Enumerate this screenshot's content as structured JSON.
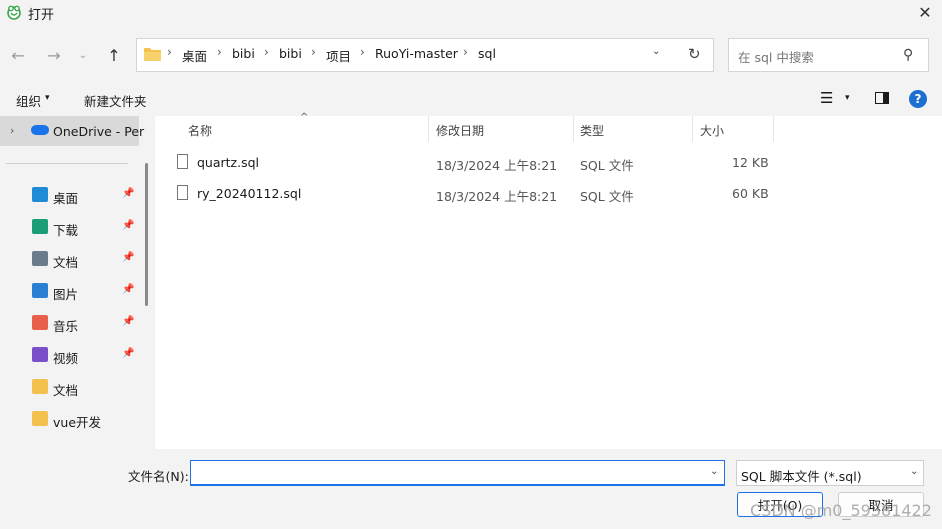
{
  "window": {
    "title": "打开",
    "close_glyph": "✕"
  },
  "nav": {
    "back_glyph": "←",
    "forward_glyph": "→",
    "recent_glyph": "⌄",
    "up_glyph": "↑",
    "breadcrumbs": [
      "桌面",
      "bibi",
      "bibi",
      "项目",
      "RuoYi-master",
      "sql"
    ],
    "sep_glyph": "›",
    "dropdown_glyph": "⌄",
    "refresh_glyph": "↻"
  },
  "search": {
    "placeholder": "在 sql 中搜索",
    "icon_glyph": "⚲"
  },
  "toolbar": {
    "organize_label": "组织",
    "caret": "▾",
    "new_folder_label": "新建文件夹",
    "view_glyph": "☰",
    "help_glyph": "?"
  },
  "sidebar": {
    "onedrive": {
      "label": "OneDrive - Per",
      "chev": "›"
    },
    "pin_glyph": "📌",
    "items": [
      {
        "label": "桌面",
        "icon": "desktop-icon",
        "color": "#1f8ad6",
        "pinned": true
      },
      {
        "label": "下载",
        "icon": "download-icon",
        "color": "#1b9e77",
        "pinned": true
      },
      {
        "label": "文档",
        "icon": "documents-icon",
        "color": "#6b7b8c",
        "pinned": true
      },
      {
        "label": "图片",
        "icon": "pictures-icon",
        "color": "#2a7fd4",
        "pinned": true
      },
      {
        "label": "音乐",
        "icon": "music-icon",
        "color": "#e8604c",
        "pinned": true
      },
      {
        "label": "视频",
        "icon": "videos-icon",
        "color": "#7a4fc9",
        "pinned": true
      },
      {
        "label": "文档",
        "icon": "folder-icon",
        "color": "#f2c14e",
        "pinned": false
      },
      {
        "label": "vue开发",
        "icon": "folder-icon",
        "color": "#f2c14e",
        "pinned": false
      }
    ]
  },
  "columns": {
    "name": "名称",
    "sort_glyph": "^",
    "modified": "修改日期",
    "type": "类型",
    "size": "大小"
  },
  "files": [
    {
      "name": "quartz.sql",
      "modified": "18/3/2024 上午8:21",
      "type": "SQL 文件",
      "size": "12 KB"
    },
    {
      "name": "ry_20240112.sql",
      "modified": "18/3/2024 上午8:21",
      "type": "SQL 文件",
      "size": "60 KB"
    }
  ],
  "bottom": {
    "filename_label": "文件名(N):",
    "filename_value": "",
    "caret": "⌄",
    "filetype_label": "SQL 脚本文件 (*.sql)",
    "open_label": "打开(O)",
    "cancel_label": "取消"
  },
  "watermark": "CSDN @m0_59381422",
  "colors": {
    "accent": "#1a73e8",
    "selected": "#d9d9d9",
    "folder": "#f2c14e"
  }
}
